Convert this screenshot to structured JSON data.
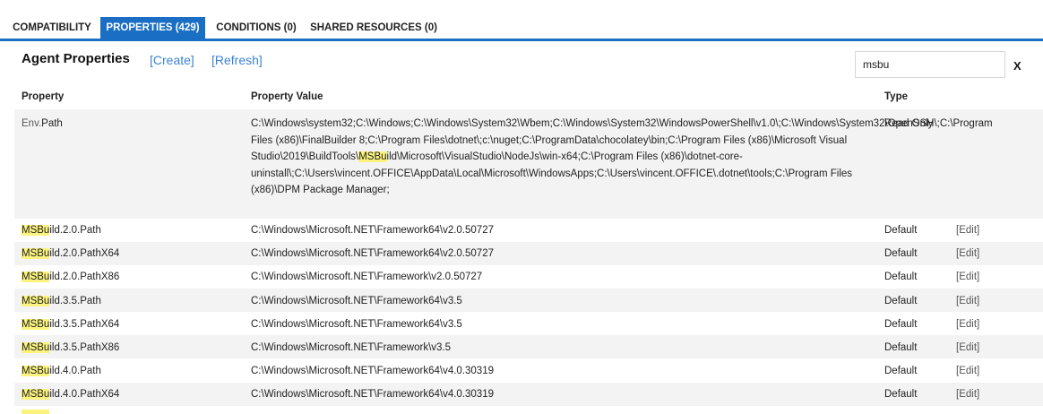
{
  "tabs": [
    {
      "label": "COMPATIBILITY",
      "active": false
    },
    {
      "label": "PROPERTIES (429)",
      "active": true
    },
    {
      "label": "CONDITIONS (0)",
      "active": false
    },
    {
      "label": "SHARED RESOURCES (0)",
      "active": false
    }
  ],
  "header": {
    "title": "Agent Properties",
    "create_label": "[Create]",
    "refresh_label": "[Refresh]"
  },
  "search": {
    "value": "msbu",
    "clear_label": "X"
  },
  "highlight_color": "#fbf37d",
  "accent_color": "#1a6fc4",
  "table": {
    "columns": [
      "Property",
      "Property Value",
      "Type"
    ],
    "rows": [
      {
        "prop_prefix": "Env.",
        "prop_rest": "Path",
        "value_before": "C:\\Windows\\system32;C:\\Windows;C:\\Windows\\System32\\Wbem;C:\\Windows\\System32\\WindowsPowerShell\\v1.0\\;C:\\Windows\\System32\\OpenSSH\\;C:\\Program Files (x86)\\FinalBuilder 8;C:\\Program Files\\dotnet\\;c:\\nuget;C:\\ProgramData\\chocolatey\\bin;C:\\Program Files (x86)\\Microsoft Visual Studio\\2019\\BuildTools\\",
        "value_hl": "MSBu",
        "value_after": "ild\\Microsoft\\VisualStudio\\NodeJs\\win-x64;C:\\Program Files (x86)\\dotnet-core-uninstall\\;C:\\Users\\vincent.OFFICE\\AppData\\Local\\Microsoft\\WindowsApps;C:\\Users\\vincent.OFFICE\\.dotnet\\tools;C:\\Program Files (x86)\\DPM Package Manager;",
        "type": "Read Only",
        "edit": ""
      },
      {
        "prop_hl": "MSBu",
        "prop_rest": "ild.2.0.Path",
        "value": "C:\\Windows\\Microsoft.NET\\Framework64\\v2.0.50727",
        "type": "Default",
        "edit": "[Edit]"
      },
      {
        "prop_hl": "MSBu",
        "prop_rest": "ild.2.0.PathX64",
        "value": "C:\\Windows\\Microsoft.NET\\Framework64\\v2.0.50727",
        "type": "Default",
        "edit": "[Edit]"
      },
      {
        "prop_hl": "MSBu",
        "prop_rest": "ild.2.0.PathX86",
        "value": "C:\\Windows\\Microsoft.NET\\Framework\\v2.0.50727",
        "type": "Default",
        "edit": "[Edit]"
      },
      {
        "prop_hl": "MSBu",
        "prop_rest": "ild.3.5.Path",
        "value": "C:\\Windows\\Microsoft.NET\\Framework64\\v3.5",
        "type": "Default",
        "edit": "[Edit]"
      },
      {
        "prop_hl": "MSBu",
        "prop_rest": "ild.3.5.PathX64",
        "value": "C:\\Windows\\Microsoft.NET\\Framework64\\v3.5",
        "type": "Default",
        "edit": "[Edit]"
      },
      {
        "prop_hl": "MSBu",
        "prop_rest": "ild.3.5.PathX86",
        "value": "C:\\Windows\\Microsoft.NET\\Framework\\v3.5",
        "type": "Default",
        "edit": "[Edit]"
      },
      {
        "prop_hl": "MSBu",
        "prop_rest": "ild.4.0.Path",
        "value": "C:\\Windows\\Microsoft.NET\\Framework64\\v4.0.30319",
        "type": "Default",
        "edit": "[Edit]"
      },
      {
        "prop_hl": "MSBu",
        "prop_rest": "ild.4.0.PathX64",
        "value": "C:\\Windows\\Microsoft.NET\\Framework64\\v4.0.30319",
        "type": "Default",
        "edit": "[Edit]"
      }
    ]
  }
}
